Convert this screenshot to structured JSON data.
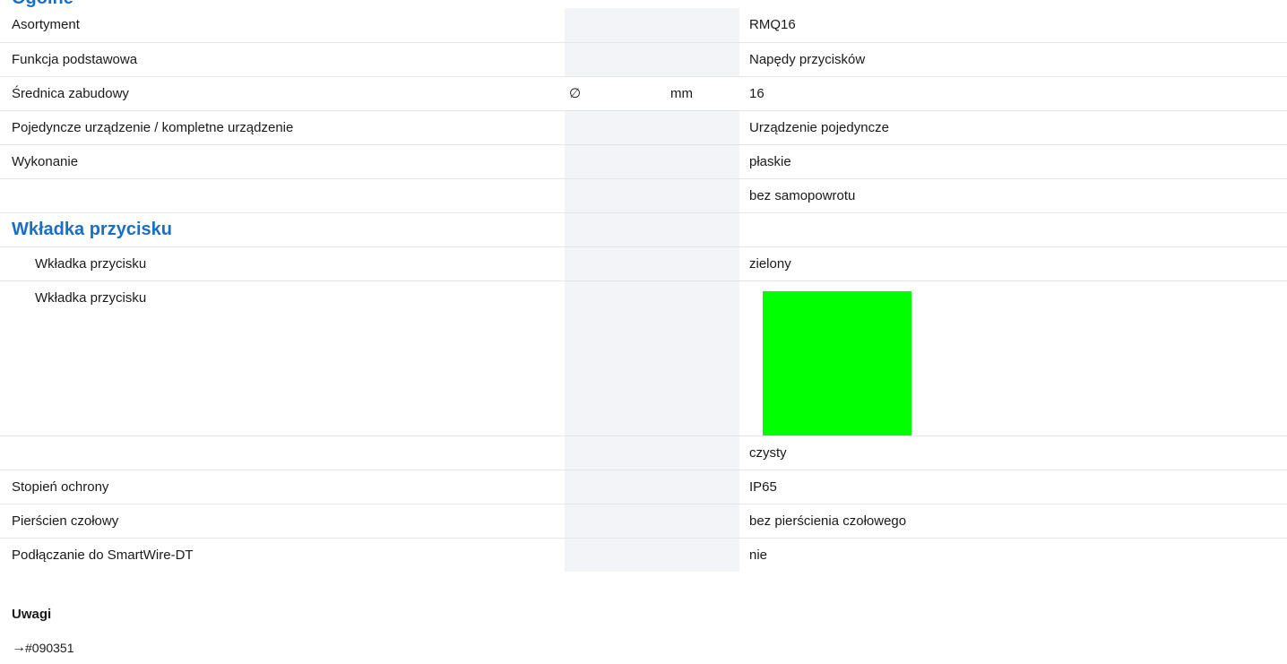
{
  "header": {
    "top_heading": "Ogólne"
  },
  "rows": {
    "r0": {
      "label": "Asortyment",
      "symbol": "",
      "unit": "",
      "value": "RMQ16"
    },
    "r1": {
      "label": "Funkcja podstawowa",
      "symbol": "",
      "unit": "",
      "value": "Napędy przycisków"
    },
    "r2": {
      "label": "Średnica zabudowy",
      "symbol": "∅",
      "unit": "mm",
      "value": "16"
    },
    "r3": {
      "label": "Pojedyncze urządzenie / kompletne urządzenie",
      "symbol": "",
      "unit": "",
      "value": "Urządzenie pojedyncze"
    },
    "r4": {
      "label": "Wykonanie",
      "symbol": "",
      "unit": "",
      "value": "płaskie"
    },
    "r5": {
      "label": "",
      "symbol": "",
      "unit": "",
      "value": "bez samopowrotu"
    },
    "section": {
      "title": "Wkładka przycisku"
    },
    "r6": {
      "label": "Wkładka przycisku",
      "symbol": "",
      "unit": "",
      "value": "zielony"
    },
    "r7": {
      "label": "Wkładka przycisku",
      "symbol": "",
      "unit": "",
      "swatch_color": "#00ff00"
    },
    "r8": {
      "label": "",
      "symbol": "",
      "unit": "",
      "value": "czysty"
    },
    "r9": {
      "label": "Stopień ochrony",
      "symbol": "",
      "unit": "",
      "value": "IP65"
    },
    "r10": {
      "label": "Pierścien czołowy",
      "symbol": "",
      "unit": "",
      "value": "bez pierścienia czołowego"
    },
    "r11": {
      "label": "Podłączanie do SmartWire-DT",
      "symbol": "",
      "unit": "",
      "value": "nie"
    }
  },
  "notes": {
    "heading": "Uwagi",
    "arrow_glyph": "→",
    "reference": "#090351"
  },
  "colors": {
    "accent": "#1a6fc4",
    "shaded_column": "#f2f4f7",
    "divider": "#e3e6ea"
  }
}
